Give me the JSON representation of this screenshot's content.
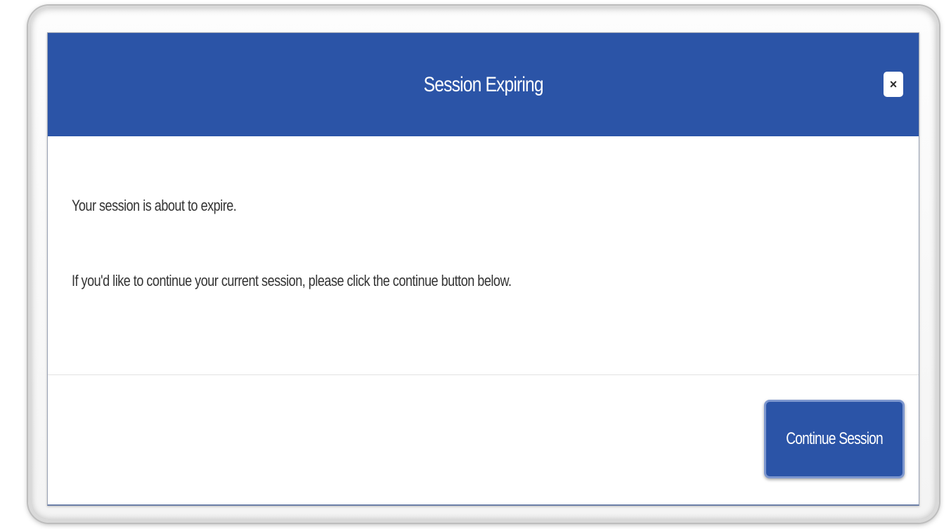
{
  "dialog": {
    "title": "Session Expiring",
    "close_icon": "close-icon",
    "close_glyph": "×",
    "message_line1": "Your session is about to expire.",
    "message_line2": "If you'd like to continue your current session, please click the continue button below.",
    "continue_label": "Continue Session"
  },
  "colors": {
    "header_bg": "#2b54a7",
    "button_bg": "#2b54a7",
    "text": "#333333"
  }
}
